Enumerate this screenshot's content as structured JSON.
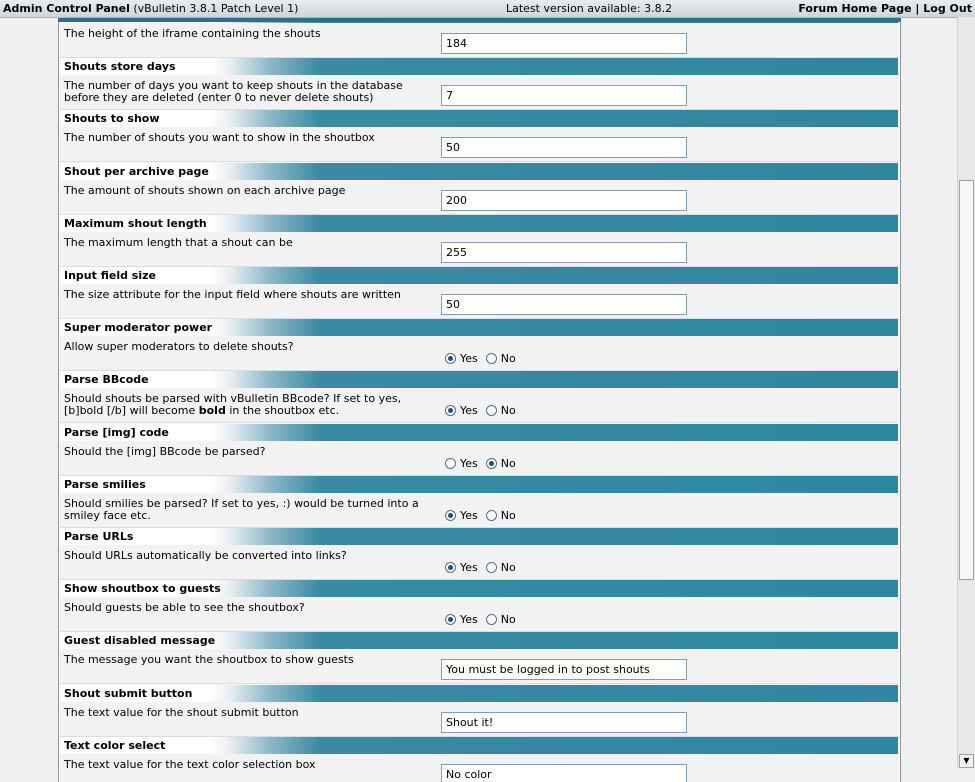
{
  "topbar": {
    "title": "Admin Control Panel",
    "version": "(vBulletin 3.8.1 Patch Level 1)",
    "latest": "Latest version available: 3.8.2",
    "home_link": "Forum Home Page",
    "separator": "|",
    "logout_link": "Log Out"
  },
  "radio_labels": {
    "yes": "Yes",
    "no": "No"
  },
  "settings": [
    {
      "title": "",
      "desc": "The height of the iframe containing the shouts",
      "type": "text",
      "value": "184"
    },
    {
      "title": "Shouts store days",
      "desc": "The number of days you want to keep shouts in the database before they are deleted (enter 0 to never delete shouts)",
      "type": "text",
      "value": "7"
    },
    {
      "title": "Shouts to show",
      "desc": "The number of shouts you want to show in the shoutbox",
      "type": "text",
      "value": "50"
    },
    {
      "title": "Shout per archive page",
      "desc": "The amount of shouts shown on each archive page",
      "type": "text",
      "value": "200"
    },
    {
      "title": "Maximum shout length",
      "desc": "The maximum length that a shout can be",
      "type": "text",
      "value": "255"
    },
    {
      "title": "Input field size",
      "desc": "The size attribute for the input field where shouts are written",
      "type": "text",
      "value": "50"
    },
    {
      "title": "Super moderator power",
      "desc": "Allow super moderators to delete shouts?",
      "type": "yesno",
      "selected": "yes"
    },
    {
      "title": "Parse BBcode",
      "desc_parts": [
        "Should shouts be parsed with vBulletin BBcode? If set to yes, [b]bold [/b] will become ",
        "bold",
        " in the shoutbox etc."
      ],
      "type": "yesno",
      "selected": "yes"
    },
    {
      "title": "Parse [img] code",
      "desc": "Should the [img] BBcode be parsed?",
      "type": "yesno",
      "selected": "no"
    },
    {
      "title": "Parse smilies",
      "desc": "Should smilies be parsed? If set to yes, :) would be turned into a smiley face etc.",
      "type": "yesno",
      "selected": "yes"
    },
    {
      "title": "Parse URLs",
      "desc": "Should URLs automatically be converted into links?",
      "type": "yesno",
      "selected": "yes"
    },
    {
      "title": "Show shoutbox to guests",
      "desc": "Should guests be able to see the shoutbox?",
      "type": "yesno",
      "selected": "yes"
    },
    {
      "title": "Guest disabled message",
      "desc": "The message you want the shoutbox to show guests",
      "type": "text",
      "value": "You must be logged in to post shouts"
    },
    {
      "title": "Shout submit button",
      "desc": "The text value for the shout submit button",
      "type": "text",
      "value": "Shout it!"
    },
    {
      "title": "Text color select",
      "desc": "The text value for the text color selection box",
      "type": "text",
      "value": "No color"
    }
  ]
}
